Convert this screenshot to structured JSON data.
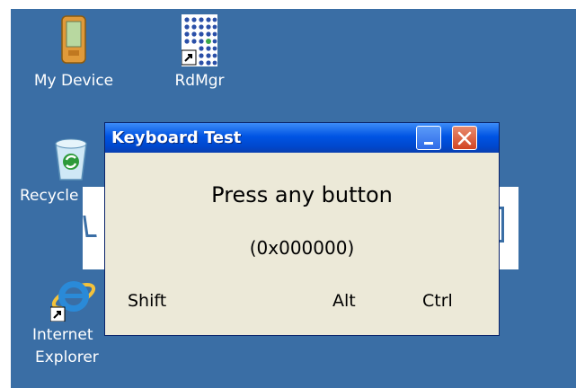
{
  "desktop": {
    "background": "#3a6ea5",
    "icons": [
      {
        "label": "My Device",
        "icon": "pda-device-icon"
      },
      {
        "label": "RdMgr",
        "icon": "rdmgr-grid-icon"
      },
      {
        "label": "Recycle",
        "icon": "recycle-bin-icon"
      },
      {
        "label": "Internet",
        "label2": "Explorer",
        "icon": "internet-explorer-icon"
      }
    ]
  },
  "dialog": {
    "title": "Keyboard Test",
    "heading": "Press any button",
    "code": "(0x000000)",
    "modifiers": {
      "shift": "Shift",
      "alt": "Alt",
      "ctrl": "Ctrl"
    }
  }
}
